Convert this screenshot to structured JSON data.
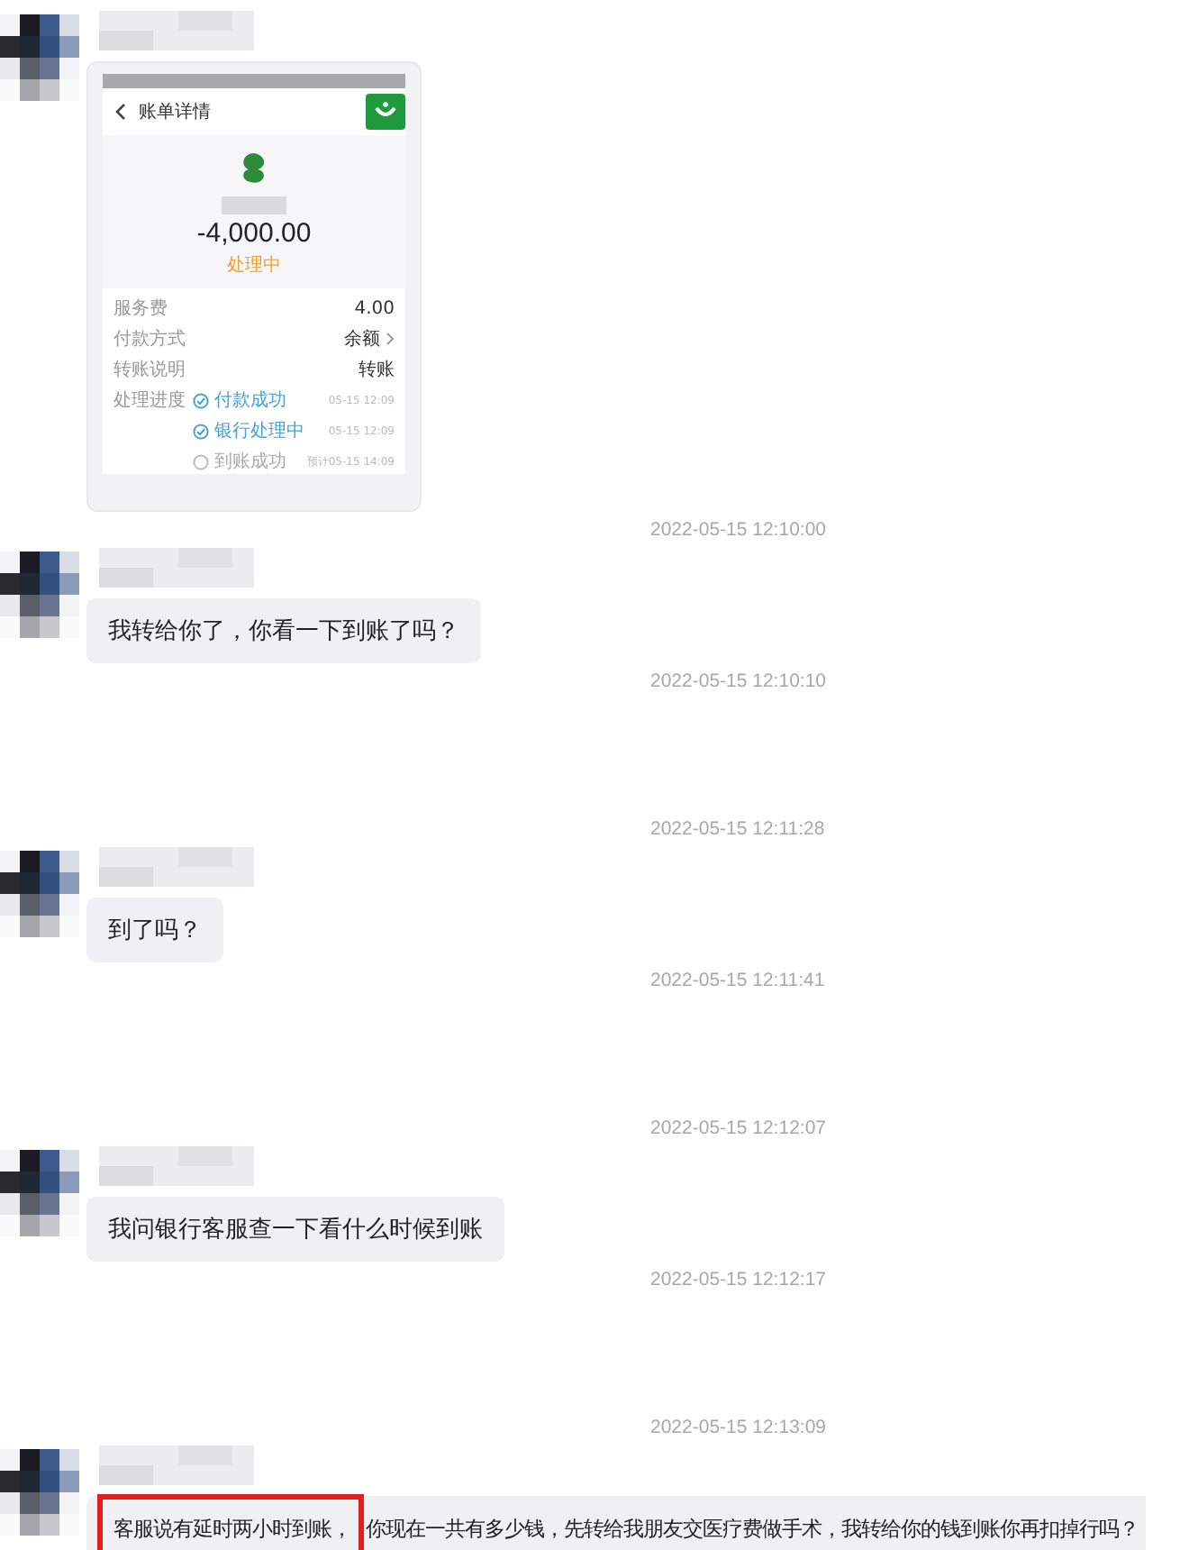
{
  "items": [
    {
      "kind": "message",
      "attachment": {
        "title": "账单详情",
        "amount": "-4,000.00",
        "status": "处理中",
        "rows": [
          {
            "label": "服务费",
            "value": "4.00",
            "link": false
          },
          {
            "label": "付款方式",
            "value": "余额",
            "link": true
          },
          {
            "label": "转账说明",
            "value": "转账",
            "link": false
          }
        ],
        "progress_label": "处理进度",
        "steps": [
          {
            "label": "付款成功",
            "time": "05-15 12:09",
            "done": true
          },
          {
            "label": "银行处理中",
            "time": "05-15 12:09",
            "done": true
          },
          {
            "label": "到账成功",
            "time": "预计05-15 14:09",
            "done": false
          }
        ]
      }
    },
    {
      "kind": "time",
      "text": "2022-05-15 12:10:00"
    },
    {
      "kind": "message",
      "parts": [
        {
          "text": "我转给你了，你看一下到账了吗？",
          "highlighted": false
        }
      ]
    },
    {
      "kind": "time",
      "text": "2022-05-15 12:10:10"
    },
    {
      "kind": "time",
      "text": "2022-05-15 12:11:28"
    },
    {
      "kind": "message",
      "parts": [
        {
          "text": "到了吗？",
          "highlighted": false
        }
      ]
    },
    {
      "kind": "time",
      "text": "2022-05-15 12:11:41"
    },
    {
      "kind": "time",
      "text": "2022-05-15 12:12:07"
    },
    {
      "kind": "message",
      "parts": [
        {
          "text": "我问银行客服查一下看什么时候到账",
          "highlighted": false
        }
      ]
    },
    {
      "kind": "time",
      "text": "2022-05-15 12:12:17"
    },
    {
      "kind": "time",
      "text": "2022-05-15 12:13:09"
    },
    {
      "kind": "message",
      "parts": [
        {
          "text": "客服说有延时两小时到账，",
          "highlighted": true
        },
        {
          "text": "你现在一共有多少钱，先转给我朋友交医疗费做手术，我转给你的钱到账你再扣掉行吗？",
          "highlighted": false
        }
      ]
    }
  ]
}
